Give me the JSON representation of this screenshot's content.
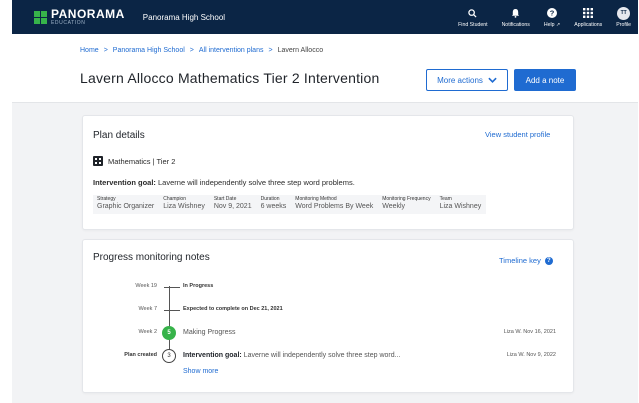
{
  "nav": {
    "logo_name": "PANORAMA",
    "logo_sub": "EDUCATION",
    "school": "Panorama High School",
    "items": [
      {
        "label": "Find Student",
        "icon": "search-icon"
      },
      {
        "label": "Notifications",
        "icon": "bell-icon"
      },
      {
        "label": "Help ↗",
        "icon": "help-icon"
      },
      {
        "label": "Applications",
        "icon": "grid-icon"
      },
      {
        "label": "Profile",
        "icon": "avatar",
        "initials": "TT"
      }
    ]
  },
  "breadcrumb": {
    "items": [
      "Home",
      "Panorama High School",
      "All intervention plans"
    ],
    "separator": ">",
    "current": "Lavern Allocco"
  },
  "page": {
    "title": "Lavern Allocco Mathematics Tier 2 Intervention",
    "more_actions": "More actions",
    "add_note": "Add a note"
  },
  "plan": {
    "title": "Plan details",
    "view_profile": "View student profile",
    "subject": "Mathematics | Tier 2",
    "goal_label": "Intervention goal:",
    "goal_text": "Laverne will independently solve three step word problems.",
    "fields": [
      {
        "label": "Strategy",
        "value": "Graphic Organizer"
      },
      {
        "label": "Champion",
        "value": "Liza Wishney"
      },
      {
        "label": "Start Date",
        "value": "Nov 9, 2021"
      },
      {
        "label": "Duration",
        "value": "6 weeks"
      },
      {
        "label": "Monitoring Method",
        "value": "Word Problems By Week"
      },
      {
        "label": "Monitoring Frequency",
        "value": "Weekly"
      },
      {
        "label": "Team",
        "value": "Liza Wishney"
      }
    ]
  },
  "progress": {
    "title": "Progress monitoring notes",
    "timeline_key": "Timeline key",
    "rows": [
      {
        "label": "Week 19",
        "text": "In Progress"
      },
      {
        "label": "Week 7",
        "text": "Expected to complete on Dec 21, 2021"
      },
      {
        "label": "Week 2",
        "badge": "5",
        "text": "Making Progress",
        "date": "Liza W. Nov 16, 2021"
      },
      {
        "label": "Plan created",
        "badge": "3",
        "goal_label": "Intervention goal:",
        "text": " Laverne will independently solve three step word...",
        "date": "Liza W. Nov 9, 2022"
      }
    ],
    "show_more": "Show more"
  },
  "colors": {
    "nav_bg": "#0b2545",
    "brand_green": "#37b34a",
    "link_blue": "#1f6bd1"
  }
}
